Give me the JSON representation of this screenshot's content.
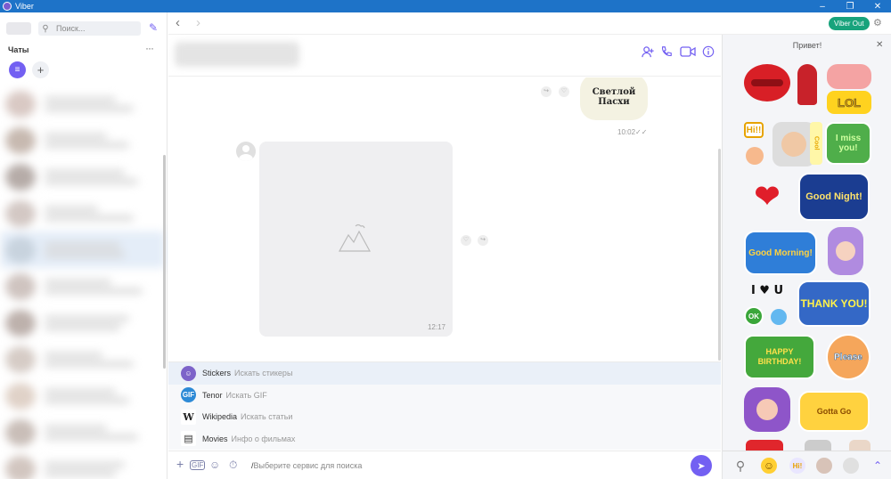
{
  "window": {
    "title": "Viber",
    "minimize": "–",
    "restore": "❐",
    "close": "✕"
  },
  "sidebar": {
    "search_placeholder": "Поиск...",
    "chats_heading": "Чаты",
    "more": "···",
    "filter_icon": "list-icon",
    "add": "+"
  },
  "navbar": {
    "back": "‹",
    "forward": "›",
    "viber_out": "Viber Out"
  },
  "chat_header": {
    "actions": [
      "add-participant-icon",
      "call-icon",
      "video-icon",
      "info-icon"
    ]
  },
  "messages": {
    "easter_sticker_line1": "Светлой",
    "easter_sticker_line2": "Пасхи",
    "time_1": "10:02",
    "time_2": "12:17"
  },
  "services": [
    {
      "name": "Stickers",
      "desc": "Искать стикеры",
      "icon": "☺",
      "color": "#7d63c9"
    },
    {
      "name": "Tenor",
      "desc": "Искать GIF",
      "icon": "GIF",
      "color": "#2d8ad6"
    },
    {
      "name": "Wikipedia",
      "desc": "Искать статьи",
      "icon": "W",
      "color": "#ffffff"
    },
    {
      "name": "Movies",
      "desc": "Инфо о фильмах",
      "icon": "▤",
      "color": "#ffffff"
    }
  ],
  "composer": {
    "placeholder": "Выберите сервис для поиска"
  },
  "sticker_panel": {
    "title": "Привет!",
    "stickers": [
      "Hi!!",
      "LOL",
      "Cool",
      "I miss you!",
      "Good Night!",
      "Good Morning!",
      "I ♥ U",
      "OK",
      "THANK YOU!",
      "HAPPY BIRTHDAY!",
      "Please",
      "Gotta Go"
    ]
  }
}
